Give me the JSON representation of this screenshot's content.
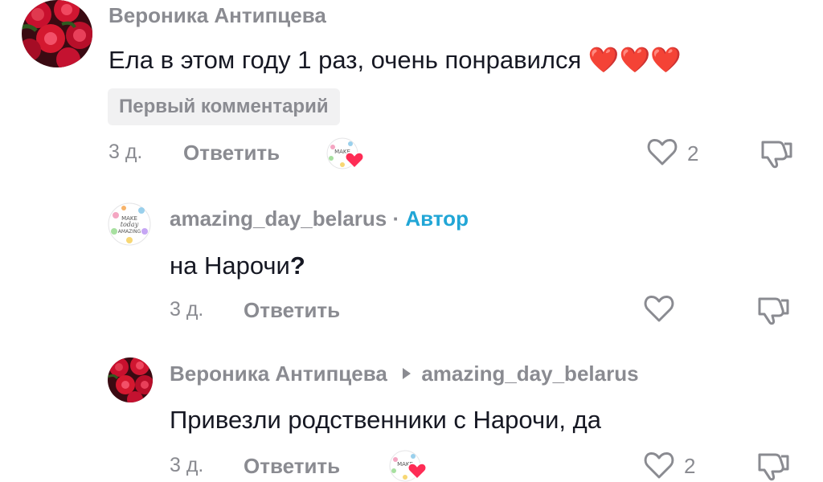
{
  "comment1": {
    "username": "Вероника Антипцева",
    "text": "Ела в этом году 1 раз, очень понравился",
    "emoji": "❤️❤️❤️",
    "badge": "Первый комментарий",
    "time": "3 д.",
    "reply": "Ответить",
    "likes": "2"
  },
  "reply1": {
    "username": "amazing_day_belarus",
    "separator": "·",
    "author_label": "Автор",
    "text": "на Нарочи",
    "text_bold": "?",
    "time": "3 д.",
    "reply": "Ответить"
  },
  "reply2": {
    "username": "Вероника Антипцева",
    "reply_to": "amazing_day_belarus",
    "text": "Привезли родственники с Нарочи, да",
    "time": "3 д.",
    "reply": "Ответить",
    "likes": "2"
  },
  "colors": {
    "author": "#21a6d6",
    "secondary": "#8a8b91",
    "heart": "#fe2c55"
  }
}
